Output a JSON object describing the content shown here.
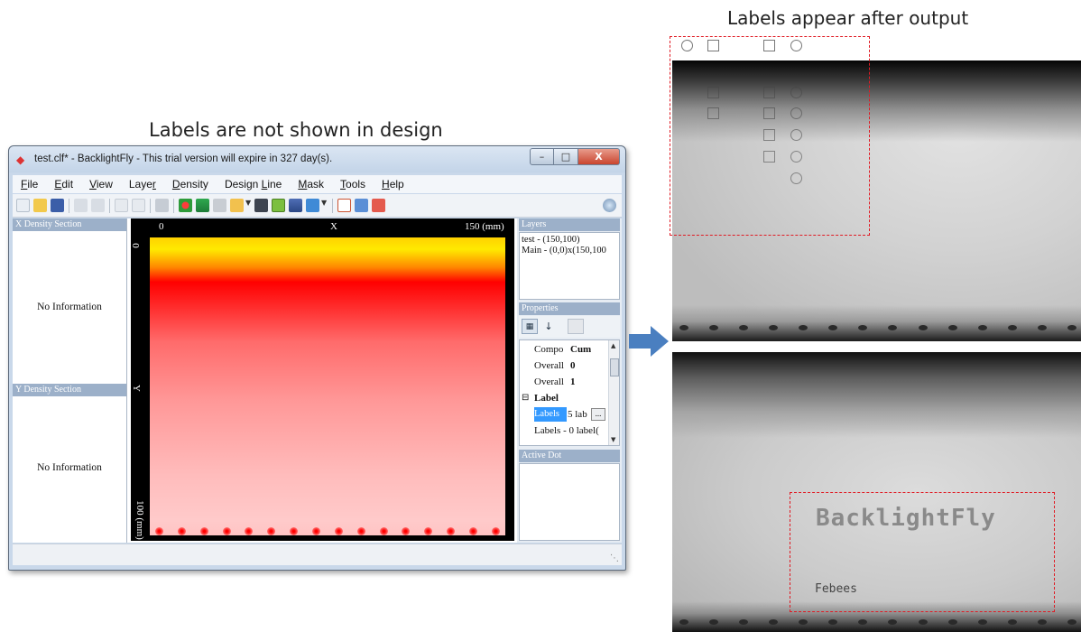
{
  "captions": {
    "left": "Labels are not shown in design",
    "right": "Labels appear after output"
  },
  "window": {
    "title": "test.clf* - BacklightFly - This trial version will expire in 327 day(s).",
    "controls": {
      "close": "X"
    }
  },
  "menu": [
    {
      "underline": "F",
      "rest": "ile"
    },
    {
      "underline": "E",
      "rest": "dit"
    },
    {
      "underline": "V",
      "rest": "iew"
    },
    {
      "pre": "Laye",
      "underline": "r",
      "rest": ""
    },
    {
      "underline": "D",
      "rest": "ensity"
    },
    {
      "pre": "Design ",
      "underline": "L",
      "rest": "ine"
    },
    {
      "underline": "M",
      "rest": "ask"
    },
    {
      "underline": "T",
      "rest": "ools"
    },
    {
      "underline": "H",
      "rest": "elp"
    }
  ],
  "left_panel": {
    "x_section": "X Density Section",
    "y_section": "Y Density Section",
    "x_info": "No Information",
    "y_info": "No Information"
  },
  "canvas": {
    "x_start": "0",
    "x_label": "X",
    "x_end": "150 (mm)",
    "y_start": "0",
    "y_label": "Y",
    "y_end": "100 (mm)"
  },
  "right_panel": {
    "layers_title": "Layers",
    "layers": [
      "test - (150,100)",
      "Main - (0,0)x(150,100"
    ],
    "properties_title": "Properties",
    "props": [
      {
        "key": "Compo",
        "value": "Cum"
      },
      {
        "key": "Overall",
        "value": "0"
      },
      {
        "key": "Overall",
        "value": "1"
      }
    ],
    "label_group": "Label",
    "label_rows": [
      {
        "key": "Labels",
        "value": "5 lab"
      },
      {
        "key": "Labels - 0 label(",
        "value": ""
      }
    ],
    "active_dot_title": "Active Dot"
  },
  "output": {
    "title_label": "BacklightFly",
    "sub_label": "Febees"
  },
  "colors": {
    "accent_dashed": "#e01b24",
    "panel_header": "#9cb0c9",
    "arrow": "#4a7fc0"
  }
}
